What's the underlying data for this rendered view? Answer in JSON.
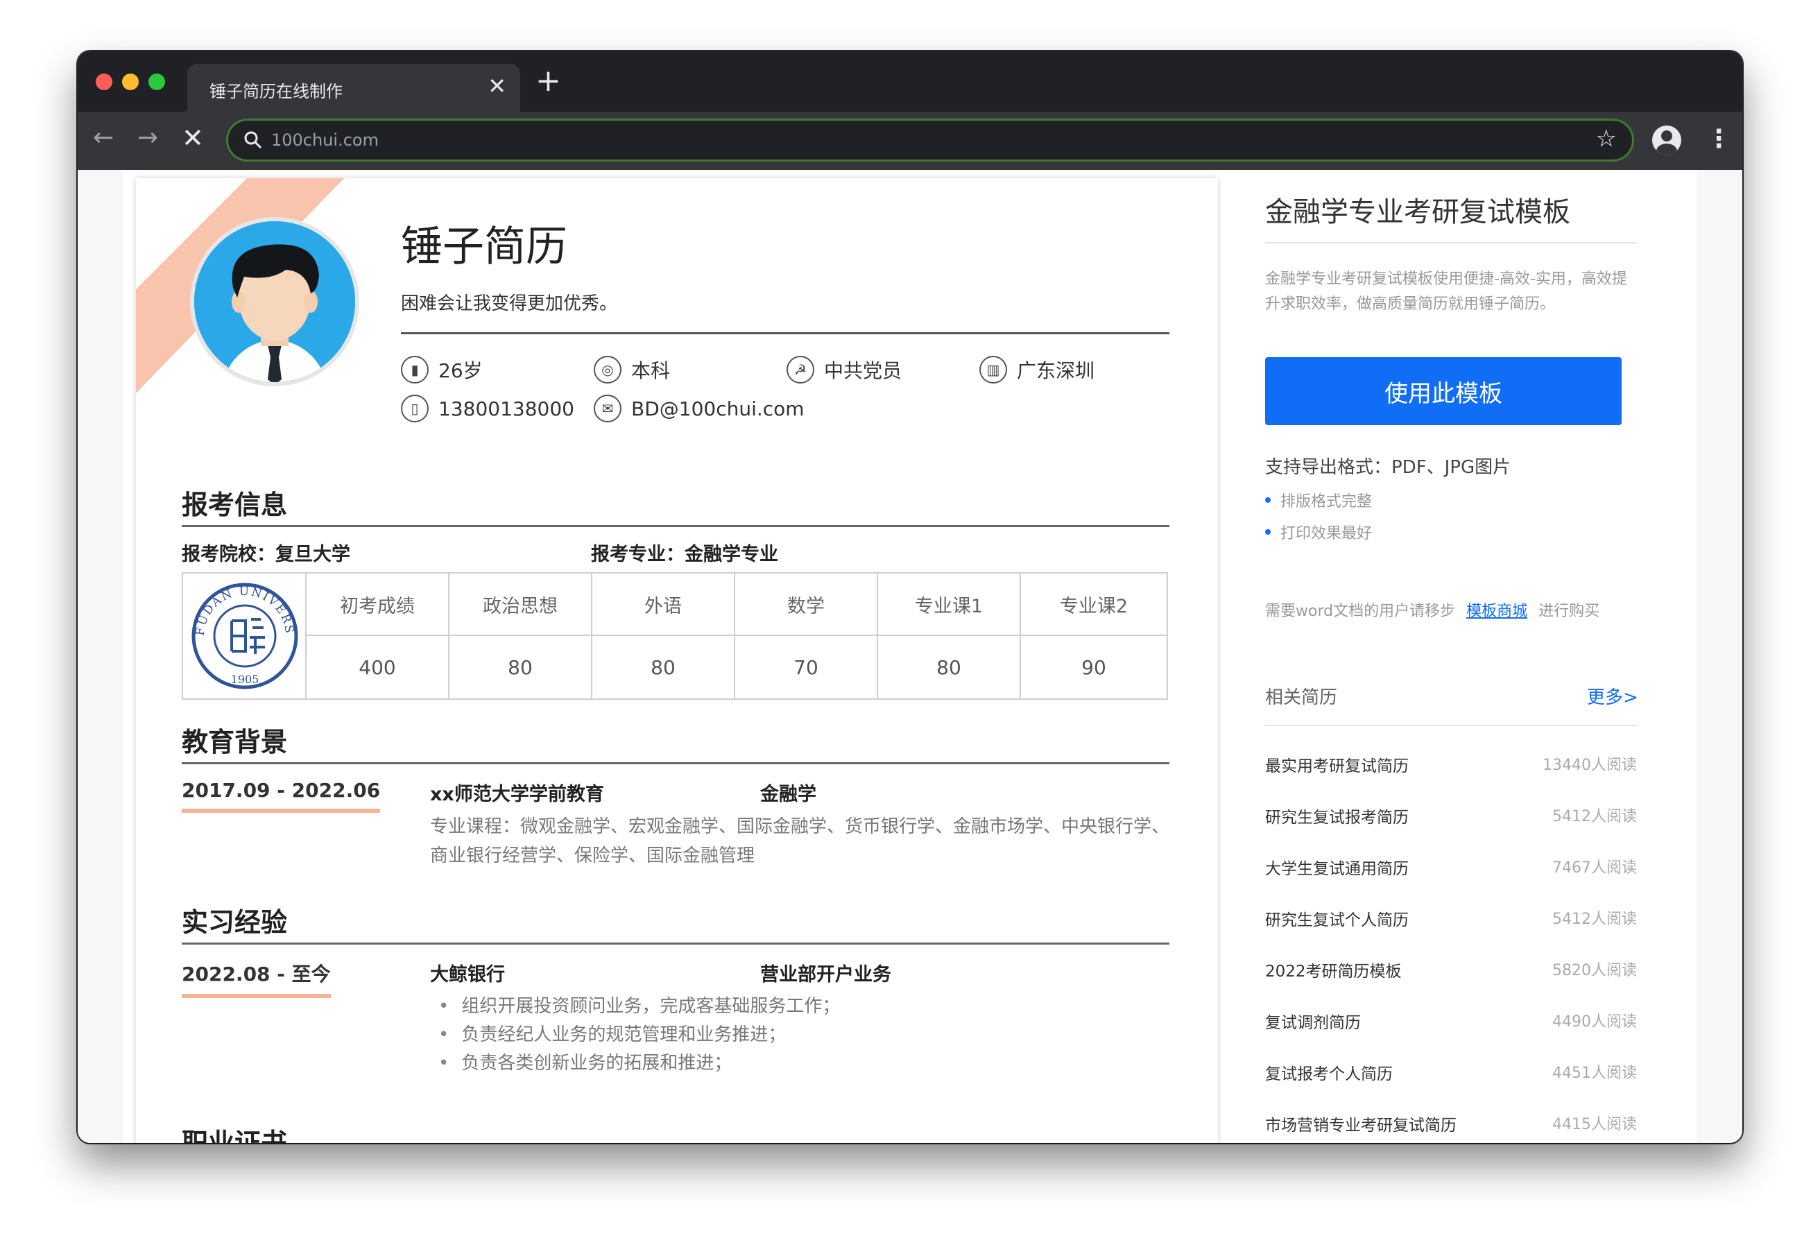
{
  "browser": {
    "tab_title": "锤子简历在线制作",
    "tab_close": "✕",
    "new_tab": "+",
    "url": "100chui.com",
    "back": "←",
    "forward": "→",
    "stop": "✕",
    "star": "☆",
    "menu": "⋮"
  },
  "resume": {
    "name": "锤子简历",
    "motto": "困难会让我变得更加优秀。",
    "info": {
      "age": "26岁",
      "degree": "本科",
      "politics": "中共党员",
      "location": "广东深圳",
      "phone": "13800138000",
      "email": "BD@100chui.com"
    },
    "sections": {
      "apply": {
        "title": "报考信息",
        "school_label": "报考院校：复旦大学",
        "major_label": "报考专业：金融学专业",
        "logo_text": "FUDAN UNIVERSITY",
        "logo_year": "1905",
        "scores": [
          {
            "subject": "初考成绩",
            "score": "400"
          },
          {
            "subject": "政治思想",
            "score": "80"
          },
          {
            "subject": "外语",
            "score": "80"
          },
          {
            "subject": "数学",
            "score": "70"
          },
          {
            "subject": "专业课1",
            "score": "80"
          },
          {
            "subject": "专业课2",
            "score": "90"
          }
        ]
      },
      "education": {
        "title": "教育背景",
        "date": "2017.09 - 2022.06",
        "school": "xx师范大学学前教育",
        "major": "金融学",
        "courses": "专业课程：微观金融学、宏观金融学、国际金融学、货币银行学、金融市场学、中央银行学、商业银行经营学、保险学、国际金融管理"
      },
      "internship": {
        "title": "实习经验",
        "date": "2022.08 - 至今",
        "company": "大鲸银行",
        "role": "营业部开户业务",
        "bullets": [
          "组织开展投资顾问业务，完成客基础服务工作；",
          "负责经纪人业务的规范管理和业务推进；",
          "负责各类创新业务的拓展和推进；"
        ]
      },
      "certificate": {
        "title": "职业证书"
      }
    }
  },
  "sidebar": {
    "title": "金融学专业考研复试模板",
    "description": "金融学专业考研复试模板使用便捷-高效-实用，高效提升求职效率，做高质量简历就用锤子简历。",
    "use_button": "使用此模板",
    "export": "支持导出格式：PDF、JPG图片",
    "features": [
      "排版格式完整",
      "打印效果最好"
    ],
    "word_note_prefix": "需要word文档的用户请移步",
    "word_note_link": "模板商城",
    "word_note_suffix": "进行购买",
    "related_title": "相关简历",
    "more": "更多>",
    "related": [
      {
        "name": "最实用考研复试简历",
        "count": "13440人阅读"
      },
      {
        "name": "研究生复试报考简历",
        "count": "5412人阅读"
      },
      {
        "name": "大学生复试通用简历",
        "count": "7467人阅读"
      },
      {
        "name": "研究生复试个人简历",
        "count": "5412人阅读"
      },
      {
        "name": "2022考研简历模板",
        "count": "5820人阅读"
      },
      {
        "name": "复试调剂简历",
        "count": "4490人阅读"
      },
      {
        "name": "复试报考个人简历",
        "count": "4451人阅读"
      },
      {
        "name": "市场营销专业考研复试简历",
        "count": "4415人阅读"
      }
    ]
  },
  "colors": {
    "accent_blue": "#0f6ef5",
    "stripe_peach": "#f9c4ad",
    "avatar_blue": "#2aa8e8",
    "omnibox_border": "#3e7a34"
  }
}
